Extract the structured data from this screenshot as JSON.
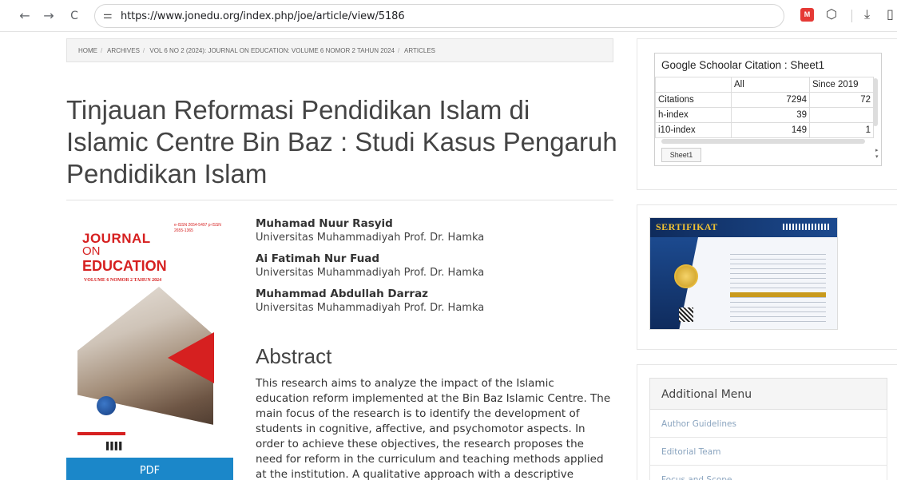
{
  "browser": {
    "url": "https://www.jonedu.org/index.php/joe/article/view/5186",
    "ext_badge": "M"
  },
  "breadcrumb": [
    "HOME",
    "ARCHIVES",
    "VOL 6 NO 2 (2024): JOURNAL ON EDUCATION: VOLUME 6 NOMOR 2 TAHUN 2024",
    "ARTICLES"
  ],
  "article": {
    "title": "Tinjauan Reformasi Pendidikan Islam di Islamic Centre Bin Baz : Studi Kasus Pengaruh Pendidikan Islam",
    "authors": [
      {
        "name": "Muhamad Nuur Rasyid",
        "affiliation": "Universitas Muhammadiyah Prof. Dr. Hamka"
      },
      {
        "name": "Ai Fatimah Nur Fuad",
        "affiliation": "Universitas Muhammadiyah Prof. Dr. Hamka"
      },
      {
        "name": "Muhammad Abdullah Darraz",
        "affiliation": "Universitas Muhammadiyah Prof. Dr. Hamka"
      }
    ],
    "abstract_heading": "Abstract",
    "abstract_text": "This research aims to analyze the impact of the Islamic education reform implemented at the Bin Baz Islamic Centre. The main focus of the research is to identify the development of students in cognitive, affective, and psychomotor aspects. In order to achieve these objectives, the research proposes the need for reform in the curriculum and teaching methods applied at the institution. A qualitative approach with a descriptive method is chosen as the",
    "pdf_label": "PDF"
  },
  "cover": {
    "line1": "JOURNAL",
    "line2": "ON",
    "line3": "EDUCATION",
    "volume": "VOLUME 6 NOMOR 2 TAHUN 2024",
    "issn": "e-ISSN 2654-5497 p-ISSN 2655-1365"
  },
  "citation_widget": {
    "title": "Google Schoolar Citation : Sheet1",
    "headers": [
      "",
      "All",
      "Since 2019"
    ],
    "rows": [
      [
        "Citations",
        "7294",
        "72"
      ],
      [
        "h-index",
        "39",
        ""
      ],
      [
        "i10-index",
        "149",
        "1"
      ]
    ],
    "sheet_tab": "Sheet1"
  },
  "certificate": {
    "title": "SERTIFIKAT"
  },
  "additional_menu": {
    "heading": "Additional Menu",
    "items": [
      "Author Guidelines",
      "Editorial Team",
      "Focus and Scope"
    ]
  }
}
